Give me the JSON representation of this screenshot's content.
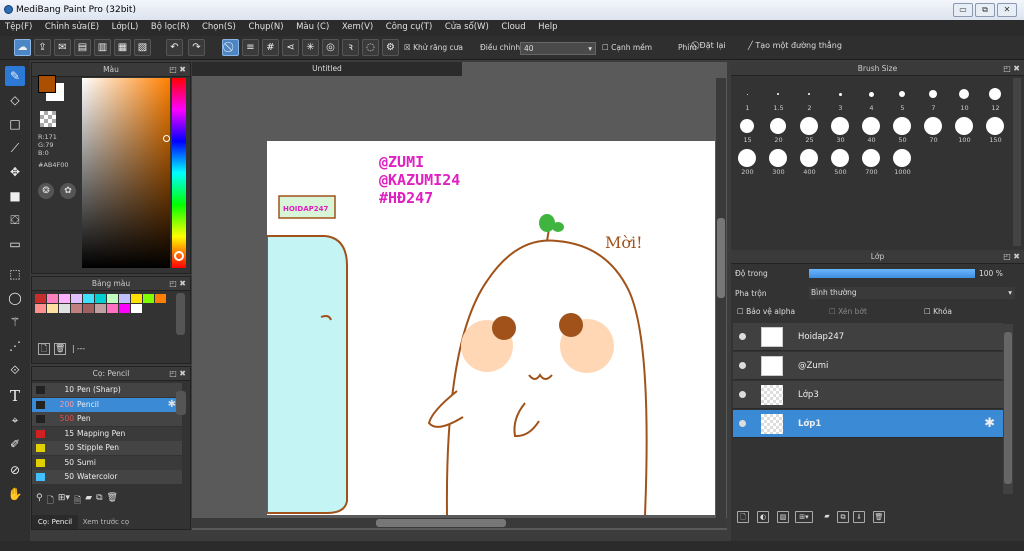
{
  "window": {
    "title": "MediBang Paint Pro (32bit)"
  },
  "menu": [
    "Tệp(F)",
    "Chỉnh sửa(E)",
    "Lớp(L)",
    "Bộ lọc(R)",
    "Chọn(S)",
    "Chụp(N)",
    "Màu (C)",
    "Xem(V)",
    "Công cụ(T)",
    "Cửa sổ(W)",
    "Cloud",
    "Help"
  ],
  "toolbar": {
    "antialias": "Khử răng cưa",
    "adjust": "Điều chỉnh",
    "adjust_value": "40",
    "soft_edge": "Cạnh mềm",
    "key": "Phím",
    "reset": "Đặt lại",
    "straight_line": "Tạo một đường thẳng"
  },
  "color_panel": {
    "title": "Màu",
    "r": "R:171",
    "g": "G:79",
    "b": "B:0",
    "hex": "#AB4F00",
    "primary": "#AB4F00",
    "secondary": "#ffffff"
  },
  "palette_panel": {
    "title": "Bảng màu",
    "row1": [
      "#c62d2d",
      "#ff80c0",
      "#ffb0ff",
      "#e0c0ff",
      "#40e0ff",
      "#00d0d0",
      "#c0ffc0",
      "#c0c0ff",
      "#ffe000",
      "#80ff00",
      "#ff8000"
    ],
    "row2": [
      "#ff9090",
      "#ffe0a0",
      "#e0e0e0",
      "#c08080",
      "#a06060",
      "#c0a0a0",
      "#ff70c0",
      "#ff00ff",
      "#ffffff"
    ],
    "input": "---"
  },
  "brush_panel": {
    "title": "Cọ: Pencil",
    "items": [
      {
        "size": "10",
        "name": "Pen (Sharp)",
        "color": "#222222"
      },
      {
        "size": "200",
        "name": "Pencil",
        "color": "#222222"
      },
      {
        "size": "500",
        "name": "Pen",
        "color": "#222222"
      },
      {
        "size": "15",
        "name": "Mapping Pen",
        "color": "#d02020"
      },
      {
        "size": "50",
        "name": "Stipple Pen",
        "color": "#e0d000"
      },
      {
        "size": "50",
        "name": "Sumi",
        "color": "#e0d000"
      },
      {
        "size": "50",
        "name": "Watercolor",
        "color": "#40c0ff"
      }
    ],
    "tab1": "Cọ: Pencil",
    "tab2": "Xem trước cọ"
  },
  "document": {
    "tab": "Untitled",
    "handles": [
      "@ZUMI",
      "@KAZUMI24",
      "#HĐ247"
    ],
    "sign": "HOIDAP247",
    "greeting": "Mời!"
  },
  "brush_size_panel": {
    "title": "Brush Size",
    "sizes": [
      "1",
      "1.5",
      "2",
      "3",
      "4",
      "5",
      "7",
      "10",
      "12",
      "15",
      "20",
      "25",
      "30",
      "40",
      "50",
      "70",
      "100",
      "150",
      "200",
      "300",
      "400",
      "500",
      "700",
      "1000"
    ]
  },
  "layer_panel": {
    "title": "Lớp",
    "opacity_label": "Độ trong",
    "opacity_value": "100 %",
    "blend_label": "Pha trộn",
    "blend_value": "Bình thường",
    "protect_alpha": "Bảo vệ alpha",
    "clip": "Xén bớt",
    "lock": "Khóa",
    "layers": [
      {
        "name": "Hoidap247",
        "selected": false
      },
      {
        "name": "@Zumi",
        "selected": false
      },
      {
        "name": "Lớp3",
        "selected": false
      },
      {
        "name": "Lớp1",
        "selected": true
      }
    ]
  }
}
